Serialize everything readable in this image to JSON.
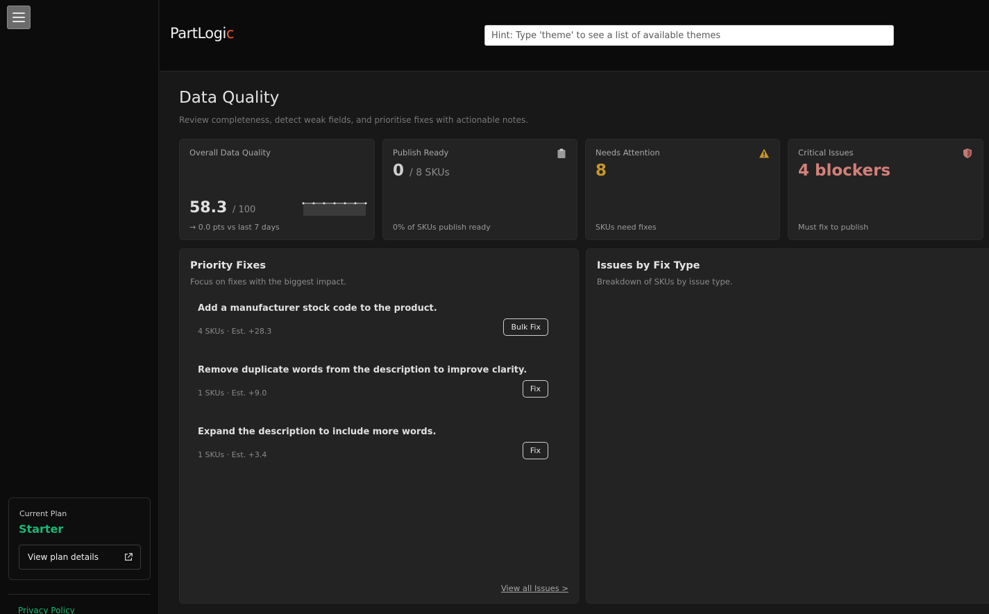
{
  "app": {
    "logo_part1": "PartLogi",
    "logo_dot": "c",
    "search_placeholder": "Hint: Type 'theme' to see a list of available themes"
  },
  "sidebar": {
    "plan_label": "Current Plan",
    "plan_name": "Starter",
    "plan_button": "View plan details",
    "privacy_link": "Privacy Policy"
  },
  "page": {
    "title": "Data Quality",
    "subtitle": "Review completeness, detect weak fields, and prioritise fixes with actionable notes."
  },
  "stats": {
    "overall": {
      "label": "Overall Data Quality",
      "value": "58.3",
      "max": "/ 100",
      "trend": "→ 0.0 pts vs last 7 days",
      "sparkline": [
        58.3,
        58.3,
        58.3,
        58.3,
        58.3,
        58.3,
        58.3
      ]
    },
    "publish": {
      "label": "Publish Ready",
      "value": "0",
      "total": "/ 8 SKUs",
      "foot": "0% of SKUs publish ready"
    },
    "attention": {
      "label": "Needs Attention",
      "value": "8",
      "foot": "SKUs need fixes"
    },
    "critical": {
      "label": "Critical Issues",
      "value": "4 blockers",
      "foot": "Must fix to publish"
    }
  },
  "colors": {
    "accent_green": "#18b874",
    "warning": "#c9962a",
    "critical": "#d3807a"
  },
  "priority_fixes": {
    "title": "Priority Fixes",
    "subtitle": "Focus on fixes with the biggest impact.",
    "items": [
      {
        "title": "Add a manufacturer stock code to the product.",
        "meta": "4 SKUs · Est. +28.3",
        "button": "Bulk Fix"
      },
      {
        "title": "Remove duplicate words from the description to improve clarity.",
        "meta": "1 SKUs · Est. +9.0",
        "button": "Fix"
      },
      {
        "title": "Expand the description to include more words.",
        "meta": "1 SKUs · Est. +3.4",
        "button": "Fix"
      }
    ],
    "view_all": "View all Issues >"
  },
  "issues_by_type": {
    "title": "Issues by Fix Type",
    "subtitle": "Breakdown of SKUs by issue type."
  }
}
